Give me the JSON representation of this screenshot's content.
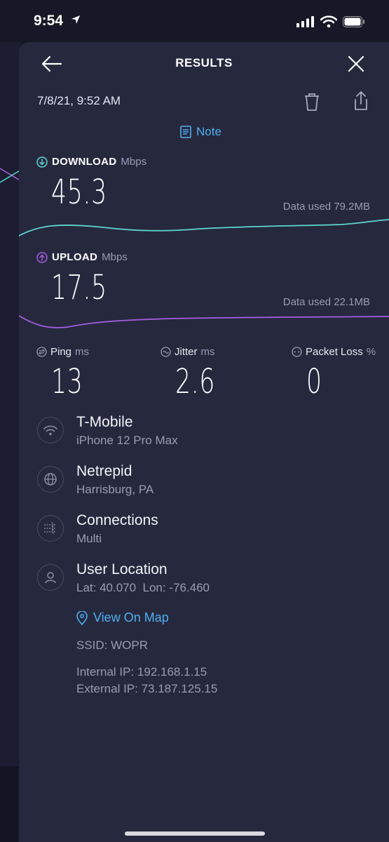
{
  "status_bar": {
    "time": "9:54",
    "icons": [
      "location-arrow-icon",
      "cellular-signal-icon",
      "wifi-icon",
      "battery-icon"
    ]
  },
  "header": {
    "title": "RESULTS",
    "back_icon": "arrow-left-icon",
    "close_icon": "close-icon"
  },
  "result": {
    "date": "7/8/21, 9:52 AM",
    "note_label": "Note",
    "download": {
      "label": "DOWNLOAD",
      "unit": "Mbps",
      "value": "45.3",
      "data_used": "Data used 79.2MB"
    },
    "upload": {
      "label": "UPLOAD",
      "unit": "Mbps",
      "value": "17.5",
      "data_used": "Data used 22.1MB"
    },
    "ping": {
      "label": "Ping",
      "unit": "ms",
      "value": "13"
    },
    "jitter": {
      "label": "Jitter",
      "unit": "ms",
      "value": "2.6"
    },
    "packet_loss": {
      "label": "Packet Loss",
      "unit": "%",
      "value": "0"
    }
  },
  "details": {
    "carrier": {
      "title": "T-Mobile",
      "subtitle": "iPhone 12 Pro Max"
    },
    "server": {
      "title": "Netrepid",
      "subtitle": "Harrisburg, PA"
    },
    "connections": {
      "title": "Connections",
      "subtitle": "Multi"
    },
    "user_location": {
      "title": "User Location",
      "subtitle": "Lat: 40.070  Lon: -76.460"
    },
    "view_on_map": "View On Map",
    "ssid": "SSID: WOPR",
    "internal_ip": "Internal IP: 192.168.1.15",
    "external_ip": "External IP: 73.187.125.15"
  },
  "colors": {
    "accent_blue": "#4fb0f0",
    "download_line": "#5ed6d0",
    "upload_line": "#a55ee0",
    "sheet_bg": "#26283e"
  }
}
